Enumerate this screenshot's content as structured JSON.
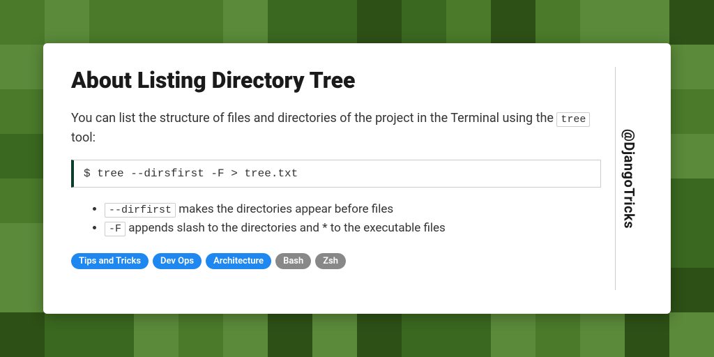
{
  "title": "About Listing Directory Tree",
  "handle": "@DjangoTricks",
  "intro": {
    "before": "You can list the structure of files and directories of the project in the Terminal using the ",
    "code": "tree",
    "after": " tool:"
  },
  "command": "$ tree --dirsfirst -F > tree.txt",
  "bullets": [
    {
      "code": "--dirfirst",
      "text": " makes the directories appear before files"
    },
    {
      "code": "-F",
      "text": " appends slash to the directories and * to the executable files"
    }
  ],
  "tags": [
    {
      "label": "Tips and Tricks",
      "variant": "blue"
    },
    {
      "label": "Dev Ops",
      "variant": "blue"
    },
    {
      "label": "Architecture",
      "variant": "blue"
    },
    {
      "label": "Bash",
      "variant": "gray"
    },
    {
      "label": "Zsh",
      "variant": "gray"
    }
  ]
}
